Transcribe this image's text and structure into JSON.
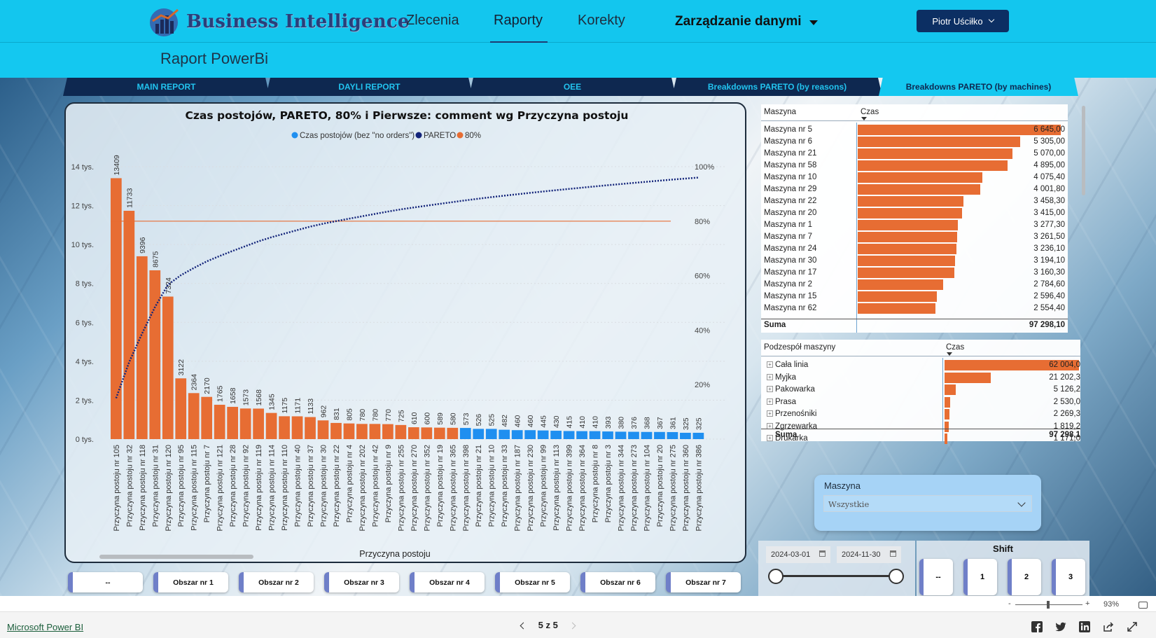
{
  "app": {
    "brand": "Business Intelligence",
    "nav": [
      "Zlecenia",
      "Raporty",
      "Korekty"
    ],
    "nav_active": "Raporty",
    "nav_dropdown": "Zarządzanie danymi",
    "user": "Piotr Uściłko",
    "page_title": "Raport PowerBi"
  },
  "tabs": [
    "MAIN REPORT",
    "DAYLI REPORT",
    "OEE",
    "Breakdowns PARETO (by reasons)",
    "Breakdowns PARETO (by machines)"
  ],
  "tab_active": "Breakdowns PARETO (by machines)",
  "chart_data": {
    "type": "bar",
    "title": "Czas postojów, PARETO, 80% i Pierwsze: comment wg Przyczyna postoju",
    "xlabel": "Przyczyna postoju",
    "ylabel": "",
    "legend": [
      "Czas postojów (bez \"no orders\")",
      "PARETO",
      "80%"
    ],
    "legend_position": "top",
    "colors": {
      "bar_main": "#e76d33",
      "bar_tail": "#1f8ff0",
      "pareto": "#13247a",
      "threshold": "#e76d33"
    },
    "y_ticks": [
      "0 tys.",
      "2 tys.",
      "4 tys.",
      "6 tys.",
      "8 tys.",
      "10 tys.",
      "12 tys.",
      "14 tys."
    ],
    "y2_ticks": [
      "20%",
      "40%",
      "60%",
      "80%",
      "100%"
    ],
    "ylim": [
      0,
      14000
    ],
    "y2lim": [
      0,
      100
    ],
    "threshold": 80,
    "categories": [
      "Przyczyna postoju nr 105",
      "Przyczyna postoju nr 32",
      "Przyczyna postoju nr 118",
      "Przyczyna postoju nr 31",
      "Przyczyna postoju nr 120",
      "Przyczyna postoju nr 95",
      "Przyczyna postoju nr 115",
      "Przyczyna postoju nr 7",
      "Przyczyna postoju nr 121",
      "Przyczyna postoju nr 28",
      "Przyczyna postoju nr 92",
      "Przyczyna postoju nr 119",
      "Przyczyna postoju nr 114",
      "Przyczyna postoju nr 110",
      "Przyczyna postoju nr 40",
      "Przyczyna postoju nr 37",
      "Przyczyna postoju nr 30",
      "Przyczyna postoju nr 22",
      "Przyczyna postoju nr 4",
      "Przyczyna postoju nr 202",
      "Przyczyna postoju nr 42",
      "Przyczyna postoju nr 9",
      "Przyczyna postoju nr 255",
      "Przyczyna postoju nr 270",
      "Przyczyna postoju nr 352",
      "Przyczyna postoju nr 19",
      "Przyczyna postoju nr 365",
      "Przyczyna postoju nr 398",
      "Przyczyna postoju nr 21",
      "Przyczyna postoju nr 10",
      "Przyczyna postoju nr 33",
      "Przyczyna postoju nr 187",
      "Przyczyna postoju nr 230",
      "Przyczyna postoju nr 99",
      "Przyczyna postoju nr 113",
      "Przyczyna postoju nr 399",
      "Przyczyna postoju nr 364",
      "Przyczyna postoju nr 8",
      "Przyczyna postoju nr 3",
      "Przyczyna postoju nr 344",
      "Przyczyna postoju nr 273",
      "Przyczyna postoju nr 104",
      "Przyczyna postoju nr 20",
      "Przyczyna postoju nr 275",
      "Przyczyna postoju nr 360",
      "Przyczyna postoju nr 386"
    ],
    "values": [
      13409,
      11733,
      9396,
      8675,
      7324,
      3122,
      2364,
      2170,
      1765,
      1658,
      1573,
      1568,
      1345,
      1175,
      1171,
      1133,
      962,
      831,
      805,
      780,
      780,
      770,
      725,
      610,
      600,
      589,
      580,
      573,
      526,
      525,
      482,
      460,
      460,
      445,
      430,
      415,
      410,
      410,
      393,
      380,
      376,
      368,
      367,
      361,
      325,
      325
    ],
    "data_labels": [
      "13409",
      "11733",
      "9396",
      "8675",
      "7324",
      "3122",
      "2364",
      "2170",
      "1765",
      "1658",
      "1573",
      "1568",
      "1345",
      "1175",
      "1171",
      "1133",
      "962",
      "831",
      "805",
      "780",
      "780",
      "770",
      "725",
      "610",
      "600",
      "589",
      "580",
      "573",
      "526",
      "525",
      "482",
      "460",
      "460",
      "445",
      "430",
      "415",
      "410",
      "410",
      "393",
      "380",
      "376",
      "368",
      "367",
      "361",
      "325",
      "325"
    ],
    "highlighted_count": 27
  },
  "machine_table": {
    "headers": [
      "Maszyna",
      "Czas"
    ],
    "rows": [
      {
        "name": "Maszyna nr 5",
        "value": "6 645,00",
        "num": 6645.0
      },
      {
        "name": "Maszyna nr 6",
        "value": "5 305,00",
        "num": 5305.0
      },
      {
        "name": "Maszyna nr 21",
        "value": "5 070,00",
        "num": 5070.0
      },
      {
        "name": "Maszyna nr 58",
        "value": "4 895,00",
        "num": 4895.0
      },
      {
        "name": "Maszyna nr 10",
        "value": "4 075,40",
        "num": 4075.4
      },
      {
        "name": "Maszyna nr 29",
        "value": "4 001,80",
        "num": 4001.8
      },
      {
        "name": "Maszyna nr 22",
        "value": "3 458,30",
        "num": 3458.3
      },
      {
        "name": "Maszyna nr 20",
        "value": "3 415,00",
        "num": 3415.0
      },
      {
        "name": "Maszyna nr 1",
        "value": "3 277,30",
        "num": 3277.3
      },
      {
        "name": "Maszyna nr 7",
        "value": "3 261,50",
        "num": 3261.5
      },
      {
        "name": "Maszyna nr 24",
        "value": "3 236,10",
        "num": 3236.1
      },
      {
        "name": "Maszyna nr 30",
        "value": "3 194,10",
        "num": 3194.1
      },
      {
        "name": "Maszyna nr 17",
        "value": "3 160,30",
        "num": 3160.3
      },
      {
        "name": "Maszyna nr 2",
        "value": "2 784,60",
        "num": 2784.6
      },
      {
        "name": "Maszyna nr 15",
        "value": "2 596,40",
        "num": 2596.4
      },
      {
        "name": "Maszyna nr 62",
        "value": "2 554,40",
        "num": 2554.4
      }
    ],
    "sum_label": "Suma",
    "sum_value": "97 298,10"
  },
  "component_table": {
    "headers": [
      "Podzespół maszyny",
      "Czas"
    ],
    "rows": [
      {
        "name": "Cała linia",
        "value": "62 004,0",
        "num": 62004.0
      },
      {
        "name": "Myjka",
        "value": "21 202,3",
        "num": 21202.3
      },
      {
        "name": "Pakowarka",
        "value": "5 126,2",
        "num": 5126.2
      },
      {
        "name": "Prasa",
        "value": "2 530,0",
        "num": 2530.0
      },
      {
        "name": "Przenośniki",
        "value": "2 269,3",
        "num": 2269.3
      },
      {
        "name": "Zgrzewarka",
        "value": "1 819,2",
        "num": 1819.2
      },
      {
        "name": "Drukarka",
        "value": "1 171,0",
        "num": 1171.0
      }
    ],
    "sum_label": "Suma",
    "sum_value": "97 298,1"
  },
  "slicer_machine": {
    "label": "Maszyna",
    "value": "Wszystkie"
  },
  "date_slicer": {
    "from": "2024-03-01",
    "to": "2024-11-30"
  },
  "shift": {
    "label": "Shift",
    "options": [
      "--",
      "1",
      "2",
      "3"
    ]
  },
  "areas": [
    "--",
    "Obszar nr 1",
    "Obszar nr 2",
    "Obszar nr 3",
    "Obszar nr 4",
    "Obszar nr 5",
    "Obszar nr 6",
    "Obszar nr 7"
  ],
  "zoom": {
    "minus": "-",
    "plus": "+",
    "level": "93%"
  },
  "footer": {
    "brand_link": "Microsoft Power BI",
    "pager": "5 z 5"
  }
}
